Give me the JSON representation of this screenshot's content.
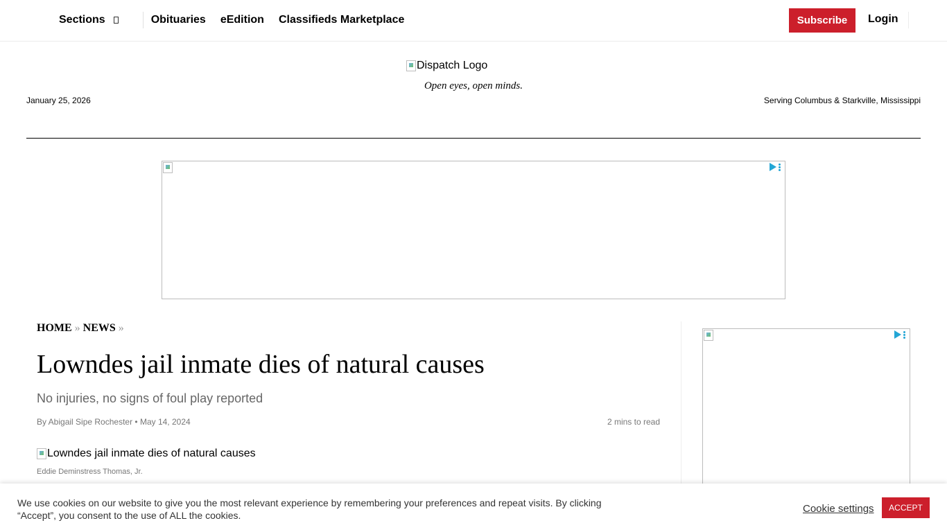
{
  "nav": {
    "sections_label": "Sections",
    "items": [
      "Obituaries",
      "eEdition",
      "Classifieds Marketplace"
    ],
    "subscribe_label": "Subscribe",
    "login_label": "Login"
  },
  "masthead": {
    "logo_alt": "Dispatch Logo",
    "tagline": "Open eyes, open minds.",
    "date": "January 25, 2026",
    "serving": "Serving Columbus & Starkville, Mississippi"
  },
  "breadcrumb": {
    "home": "HOME",
    "sep": "»",
    "news": "NEWS"
  },
  "article": {
    "headline": "Lowndes jail inmate dies of natural causes",
    "subhead": "No injuries, no signs of foul play reported",
    "byline": "By Abigail Sipe Rochester • May 14, 2024",
    "read_time": "2 mins to read",
    "image_alt": "Lowndes jail inmate dies of natural causes",
    "caption": "Eddie Deminstress Thomas, Jr."
  },
  "cookie": {
    "text": "We use cookies on our website to give you the most relevant experience by remembering your preferences and repeat visits. By clicking “Accept”, you consent to the use of ALL the cookies.",
    "settings_label": "Cookie settings",
    "accept_label": "ACCEPT"
  },
  "colors": {
    "accent": "#cc1f2b",
    "adchoices": "#23a6d5"
  },
  "icons": {
    "sections_toggle": "sections-caret-icon",
    "broken_image": "broken-image-icon",
    "adchoices": "adchoices-icon"
  }
}
